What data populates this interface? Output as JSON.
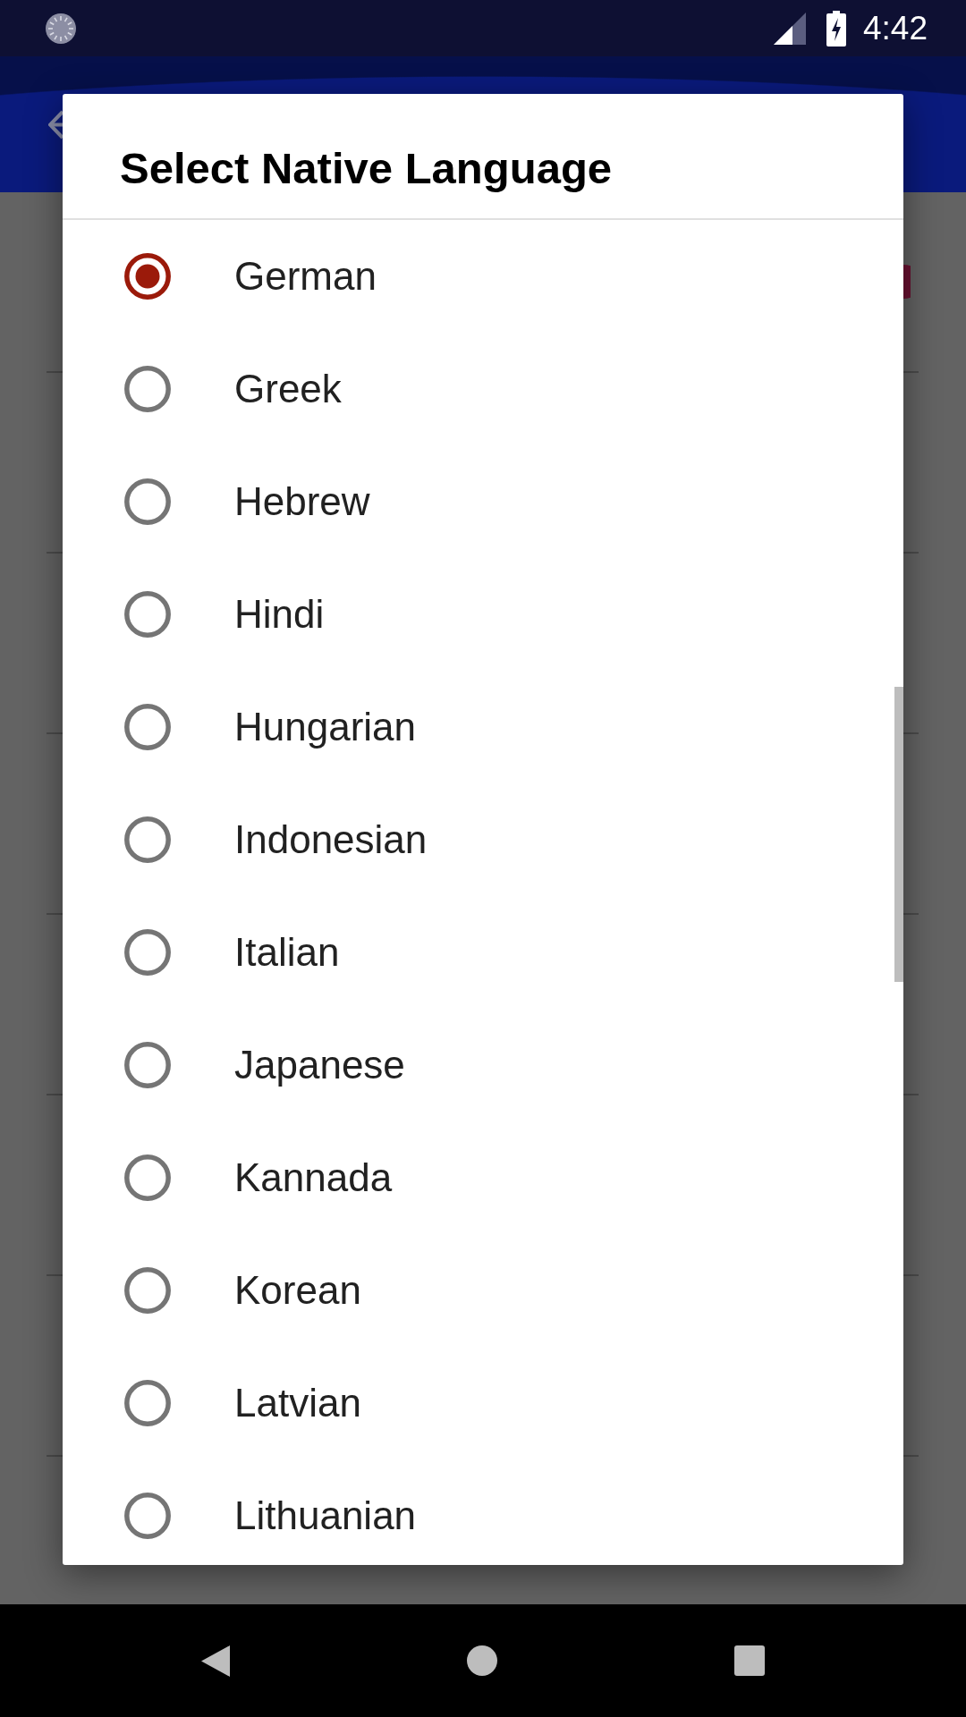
{
  "status_bar": {
    "time": "4:42"
  },
  "dialog": {
    "title": "Select Native Language",
    "options": [
      {
        "label": "German",
        "selected": true
      },
      {
        "label": "Greek",
        "selected": false
      },
      {
        "label": "Hebrew",
        "selected": false
      },
      {
        "label": "Hindi",
        "selected": false
      },
      {
        "label": "Hungarian",
        "selected": false
      },
      {
        "label": "Indonesian",
        "selected": false
      },
      {
        "label": "Italian",
        "selected": false
      },
      {
        "label": "Japanese",
        "selected": false
      },
      {
        "label": "Kannada",
        "selected": false
      },
      {
        "label": "Korean",
        "selected": false
      },
      {
        "label": "Latvian",
        "selected": false
      },
      {
        "label": "Lithuanian",
        "selected": false
      }
    ]
  }
}
